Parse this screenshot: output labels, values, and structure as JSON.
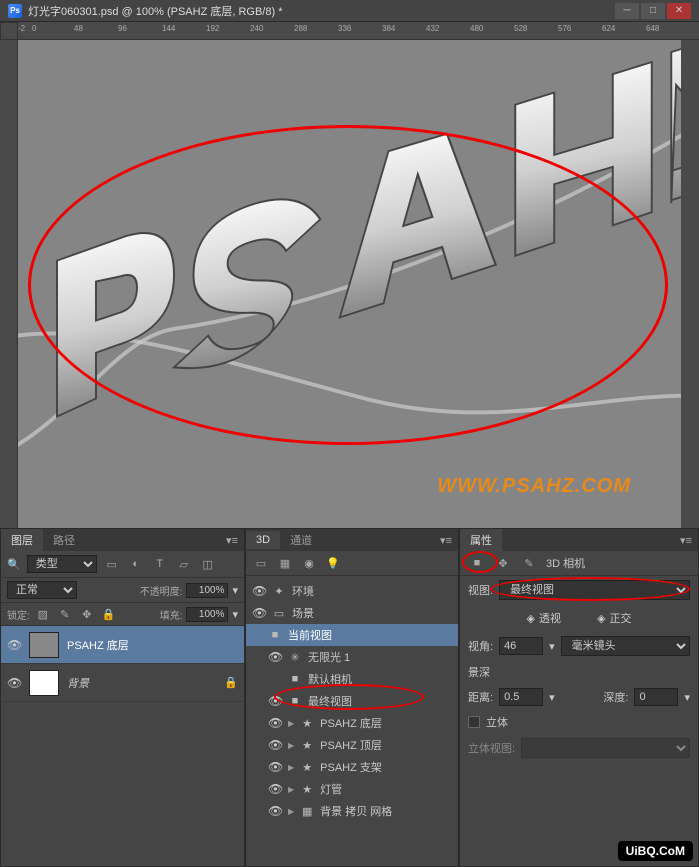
{
  "titlebar": {
    "title": "灯光字060301.psd @ 100% (PSAHZ 底层, RGB/8) *"
  },
  "ruler": {
    "ticks": [
      "-2",
      "0",
      "48",
      "96",
      "144",
      "192",
      "240",
      "288",
      "336",
      "384",
      "432",
      "480",
      "528",
      "576",
      "624",
      "648"
    ]
  },
  "canvas": {
    "watermark": "WWW.PSAHZ.COM"
  },
  "layers_panel": {
    "tab_layers": "图层",
    "tab_paths": "路径",
    "filter_label": "类型",
    "blend_mode": "正常",
    "opacity_label": "不透明度:",
    "opacity_value": "100%",
    "lock_label": "锁定:",
    "fill_label": "填充:",
    "fill_value": "100%",
    "items": [
      {
        "name": "PSAHZ 底层",
        "selected": true
      },
      {
        "name": "背景",
        "selected": false
      }
    ]
  },
  "panel3d": {
    "tab_3d": "3D",
    "tab_channels": "通道",
    "items": [
      {
        "name": "环境",
        "icon": "✦",
        "indent": 0
      },
      {
        "name": "场景",
        "icon": "▭",
        "indent": 0
      },
      {
        "name": "当前视图",
        "icon": "■",
        "indent": 1,
        "selected": true
      },
      {
        "name": "无限光 1",
        "icon": "✳",
        "indent": 1
      },
      {
        "name": "默认相机",
        "icon": "■",
        "indent": 1
      },
      {
        "name": "最终视图",
        "icon": "■",
        "indent": 1,
        "highlighted": true
      },
      {
        "name": "PSAHZ 底层",
        "icon": "★",
        "indent": 1,
        "expandable": true
      },
      {
        "name": "PSAHZ 顶层",
        "icon": "★",
        "indent": 1,
        "expandable": true
      },
      {
        "name": "PSAHZ 支架",
        "icon": "★",
        "indent": 1,
        "expandable": true
      },
      {
        "name": "灯管",
        "icon": "★",
        "indent": 1,
        "expandable": true
      },
      {
        "name": "背景 拷贝 网格",
        "icon": "▦",
        "indent": 1,
        "expandable": true
      }
    ]
  },
  "properties": {
    "tab": "属性",
    "camera_label": "3D 相机",
    "view_label": "视图:",
    "view_value": "最终视图",
    "perspective": "透视",
    "ortho": "正交",
    "fov_label": "视角:",
    "fov_value": "46",
    "lens": "毫米镜头",
    "dof_label": "景深",
    "distance_label": "距离:",
    "distance_value": "0.5",
    "depth_label": "深度:",
    "depth_value": "0",
    "stereo_label": "立体",
    "stereo_view_label": "立体视图:"
  },
  "footer_watermark": "UiBQ.CoM"
}
